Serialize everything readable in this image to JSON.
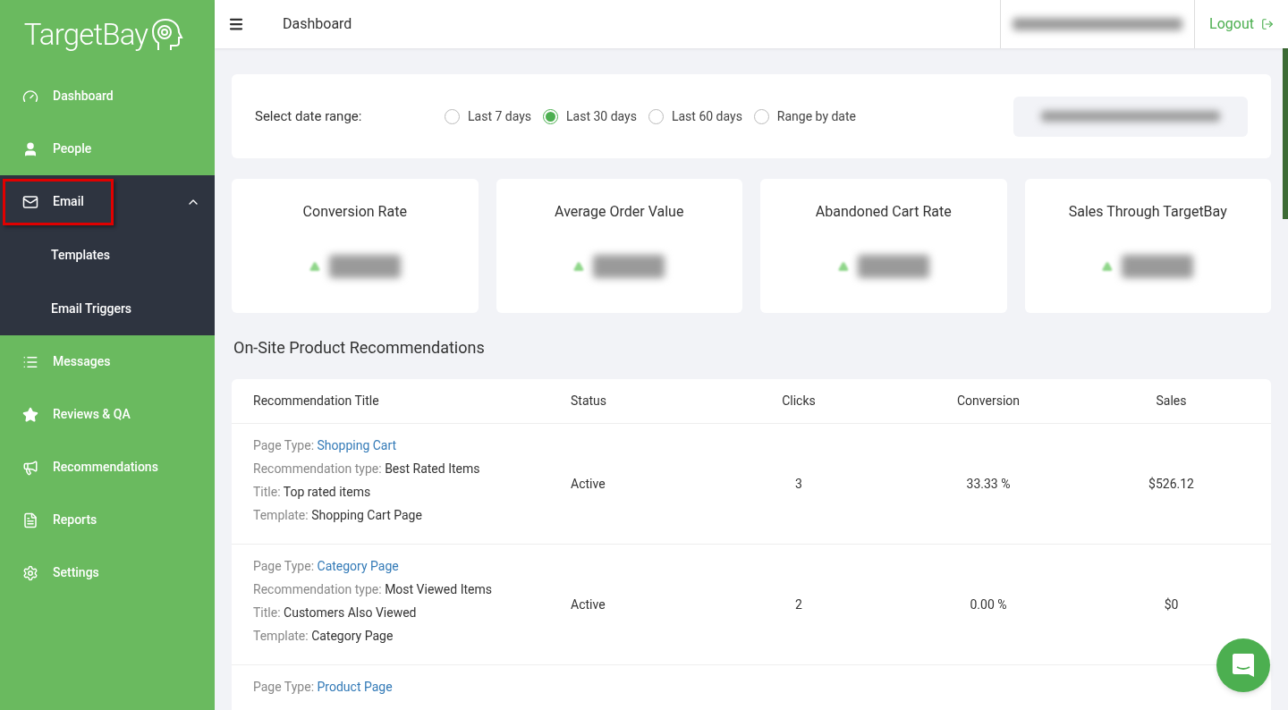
{
  "brand": {
    "name": "TargetBay"
  },
  "sidebar": {
    "items": [
      {
        "label": "Dashboard",
        "expanded": false,
        "highlighted": false
      },
      {
        "label": "People",
        "expanded": false,
        "highlighted": false
      },
      {
        "label": "Email",
        "expanded": true,
        "highlighted": true,
        "children": [
          {
            "label": "Templates"
          },
          {
            "label": "Email Triggers"
          }
        ]
      },
      {
        "label": "Messages",
        "expanded": false,
        "highlighted": false
      },
      {
        "label": "Reviews & QA",
        "expanded": false,
        "highlighted": false
      },
      {
        "label": "Recommendations",
        "expanded": false,
        "highlighted": false
      },
      {
        "label": "Reports",
        "expanded": false,
        "highlighted": false
      },
      {
        "label": "Settings",
        "expanded": false,
        "highlighted": false
      }
    ]
  },
  "header": {
    "title": "Dashboard",
    "logout": "Logout"
  },
  "date_range": {
    "label": "Select date range:",
    "options": [
      {
        "label": "Last 7 days",
        "selected": false
      },
      {
        "label": "Last 30 days",
        "selected": true
      },
      {
        "label": "Last 60 days",
        "selected": false
      },
      {
        "label": "Range by date",
        "selected": false
      }
    ]
  },
  "metrics": [
    {
      "title": "Conversion Rate"
    },
    {
      "title": "Average Order Value"
    },
    {
      "title": "Abandoned Cart Rate"
    },
    {
      "title": "Sales Through TargetBay"
    }
  ],
  "recommendations": {
    "title": "On-Site Product Recommendations",
    "columns": [
      "Recommendation Title",
      "Status",
      "Clicks",
      "Conversion",
      "Sales"
    ],
    "rows": [
      {
        "fields": [
          {
            "label": "Page Type:",
            "value": "Shopping Cart",
            "kind": "link"
          },
          {
            "label": "Recommendation type:",
            "value": "Best Rated Items",
            "kind": "text"
          },
          {
            "label": "Title:",
            "value": "Top rated items",
            "kind": "text"
          },
          {
            "label": "Template:",
            "value": "Shopping Cart Page",
            "kind": "text"
          }
        ],
        "status": "Active",
        "clicks": "3",
        "conversion": "33.33 %",
        "sales": "$526.12"
      },
      {
        "fields": [
          {
            "label": "Page Type:",
            "value": "Category Page",
            "kind": "link"
          },
          {
            "label": "Recommendation type:",
            "value": "Most Viewed Items",
            "kind": "text"
          },
          {
            "label": "Title:",
            "value": "Customers Also Viewed",
            "kind": "text"
          },
          {
            "label": "Template:",
            "value": "Category Page",
            "kind": "text"
          }
        ],
        "status": "Active",
        "clicks": "2",
        "conversion": "0.00 %",
        "sales": "$0"
      },
      {
        "fields": [
          {
            "label": "Page Type:",
            "value": "Product Page",
            "kind": "link"
          }
        ]
      }
    ]
  }
}
